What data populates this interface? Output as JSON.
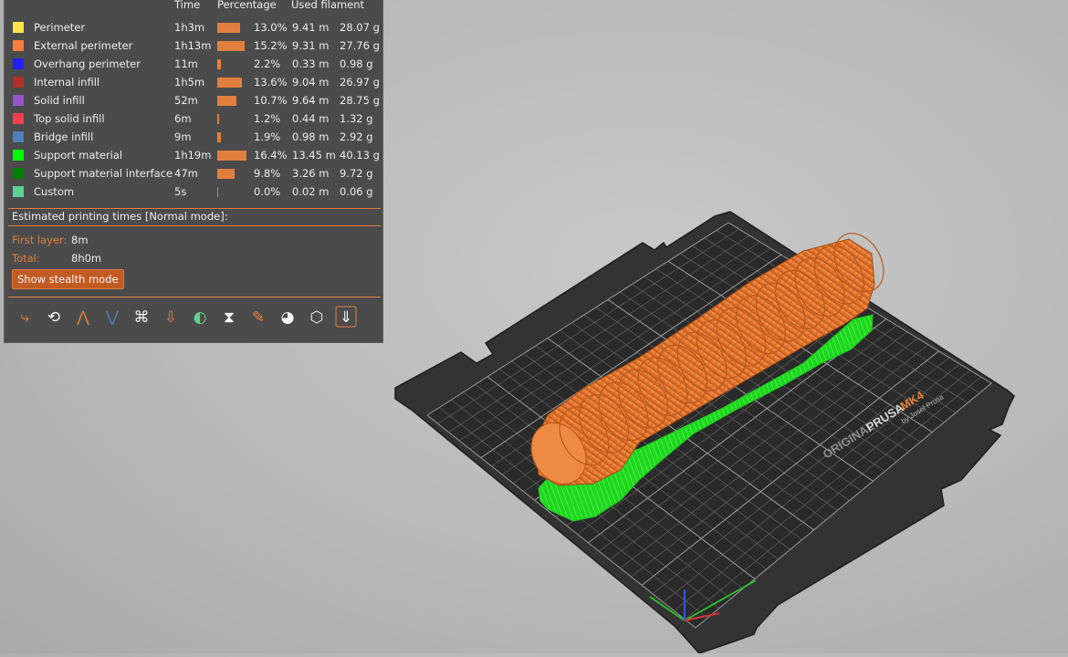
{
  "legend": {
    "headers": {
      "time": "Time",
      "percentage": "Percentage",
      "used_filament": "Used filament"
    },
    "rows": [
      {
        "name": "Perimeter",
        "color": "#ffe54a",
        "time": "1h3m",
        "pct": "13.0%",
        "pct_value": 13.0,
        "length": "9.41 m",
        "weight": "28.07 g"
      },
      {
        "name": "External perimeter",
        "color": "#ff7d38",
        "time": "1h13m",
        "pct": "15.2%",
        "pct_value": 15.2,
        "length": "9.31 m",
        "weight": "27.76 g"
      },
      {
        "name": "Overhang perimeter",
        "color": "#1f1fff",
        "time": "11m",
        "pct": "2.2%",
        "pct_value": 2.2,
        "length": "0.33 m",
        "weight": "0.98 g"
      },
      {
        "name": "Internal infill",
        "color": "#b03029",
        "time": "1h5m",
        "pct": "13.6%",
        "pct_value": 13.6,
        "length": "9.04 m",
        "weight": "26.97 g"
      },
      {
        "name": "Solid infill",
        "color": "#9654cc",
        "time": "52m",
        "pct": "10.7%",
        "pct_value": 10.7,
        "length": "9.64 m",
        "weight": "28.75 g"
      },
      {
        "name": "Top solid infill",
        "color": "#f04050",
        "time": "6m",
        "pct": "1.2%",
        "pct_value": 1.2,
        "length": "0.44 m",
        "weight": "1.32 g"
      },
      {
        "name": "Bridge infill",
        "color": "#4d80ba",
        "time": "9m",
        "pct": "1.9%",
        "pct_value": 1.9,
        "length": "0.98 m",
        "weight": "2.92 g"
      },
      {
        "name": "Support material",
        "color": "#00ff00",
        "time": "1h19m",
        "pct": "16.4%",
        "pct_value": 16.4,
        "length": "13.45 m",
        "weight": "40.13 g"
      },
      {
        "name": "Support material interface",
        "color": "#008000",
        "time": "47m",
        "pct": "9.8%",
        "pct_value": 9.8,
        "length": "3.26 m",
        "weight": "9.72 g"
      },
      {
        "name": "Custom",
        "color": "#5ed194",
        "time": "5s",
        "pct": "0.0%",
        "pct_value": 0.0,
        "length": "0.02 m",
        "weight": "0.06 g"
      }
    ],
    "estimated_label": "Estimated printing times [Normal mode]:",
    "first_layer_label": "First layer:",
    "first_layer_value": "8m",
    "total_label": "Total:",
    "total_value": "8h0m",
    "stealth_button": "Show stealth mode",
    "toolbar_icons": [
      "travel-icon",
      "wipe-icon",
      "retractions-icon",
      "deretractions-icon",
      "seams-icon",
      "tool-changes-icon",
      "color-changes-icon",
      "pause-prints-icon",
      "custom-gcodes-icon",
      "center-of-gravity-icon",
      "shells-icon",
      "tool-marker-icon"
    ]
  },
  "bed": {
    "brand_line1": "ORIGINAL",
    "brand_line2": "PRUSA",
    "brand_model": "MK4",
    "brand_sub": "by Josef Prusa"
  },
  "colors": {
    "accent": "#e37f3e",
    "panel": "#4b4b4b",
    "object": "#e8742c",
    "support": "#2ee62e"
  }
}
